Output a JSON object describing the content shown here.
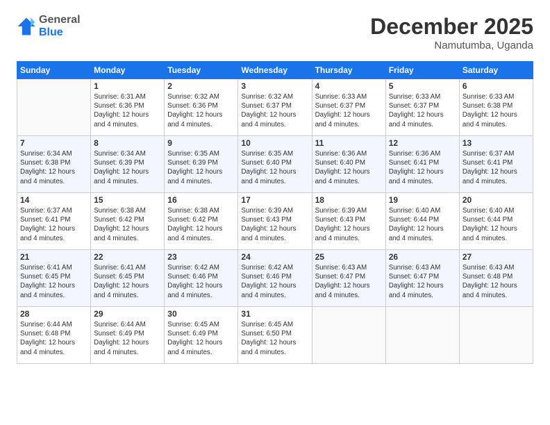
{
  "header": {
    "logo": {
      "general": "General",
      "blue": "Blue"
    },
    "month": "December 2025",
    "location": "Namutumba, Uganda"
  },
  "weekdays": [
    "Sunday",
    "Monday",
    "Tuesday",
    "Wednesday",
    "Thursday",
    "Friday",
    "Saturday"
  ],
  "weeks": [
    [
      {
        "day": null,
        "info": null
      },
      {
        "day": "1",
        "info": "Sunrise: 6:31 AM\nSunset: 6:36 PM\nDaylight: 12 hours\nand 4 minutes."
      },
      {
        "day": "2",
        "info": "Sunrise: 6:32 AM\nSunset: 6:36 PM\nDaylight: 12 hours\nand 4 minutes."
      },
      {
        "day": "3",
        "info": "Sunrise: 6:32 AM\nSunset: 6:37 PM\nDaylight: 12 hours\nand 4 minutes."
      },
      {
        "day": "4",
        "info": "Sunrise: 6:33 AM\nSunset: 6:37 PM\nDaylight: 12 hours\nand 4 minutes."
      },
      {
        "day": "5",
        "info": "Sunrise: 6:33 AM\nSunset: 6:37 PM\nDaylight: 12 hours\nand 4 minutes."
      },
      {
        "day": "6",
        "info": "Sunrise: 6:33 AM\nSunset: 6:38 PM\nDaylight: 12 hours\nand 4 minutes."
      }
    ],
    [
      {
        "day": "7",
        "info": "Sunrise: 6:34 AM\nSunset: 6:38 PM\nDaylight: 12 hours\nand 4 minutes."
      },
      {
        "day": "8",
        "info": "Sunrise: 6:34 AM\nSunset: 6:39 PM\nDaylight: 12 hours\nand 4 minutes."
      },
      {
        "day": "9",
        "info": "Sunrise: 6:35 AM\nSunset: 6:39 PM\nDaylight: 12 hours\nand 4 minutes."
      },
      {
        "day": "10",
        "info": "Sunrise: 6:35 AM\nSunset: 6:40 PM\nDaylight: 12 hours\nand 4 minutes."
      },
      {
        "day": "11",
        "info": "Sunrise: 6:36 AM\nSunset: 6:40 PM\nDaylight: 12 hours\nand 4 minutes."
      },
      {
        "day": "12",
        "info": "Sunrise: 6:36 AM\nSunset: 6:41 PM\nDaylight: 12 hours\nand 4 minutes."
      },
      {
        "day": "13",
        "info": "Sunrise: 6:37 AM\nSunset: 6:41 PM\nDaylight: 12 hours\nand 4 minutes."
      }
    ],
    [
      {
        "day": "14",
        "info": "Sunrise: 6:37 AM\nSunset: 6:41 PM\nDaylight: 12 hours\nand 4 minutes."
      },
      {
        "day": "15",
        "info": "Sunrise: 6:38 AM\nSunset: 6:42 PM\nDaylight: 12 hours\nand 4 minutes."
      },
      {
        "day": "16",
        "info": "Sunrise: 6:38 AM\nSunset: 6:42 PM\nDaylight: 12 hours\nand 4 minutes."
      },
      {
        "day": "17",
        "info": "Sunrise: 6:39 AM\nSunset: 6:43 PM\nDaylight: 12 hours\nand 4 minutes."
      },
      {
        "day": "18",
        "info": "Sunrise: 6:39 AM\nSunset: 6:43 PM\nDaylight: 12 hours\nand 4 minutes."
      },
      {
        "day": "19",
        "info": "Sunrise: 6:40 AM\nSunset: 6:44 PM\nDaylight: 12 hours\nand 4 minutes."
      },
      {
        "day": "20",
        "info": "Sunrise: 6:40 AM\nSunset: 6:44 PM\nDaylight: 12 hours\nand 4 minutes."
      }
    ],
    [
      {
        "day": "21",
        "info": "Sunrise: 6:41 AM\nSunset: 6:45 PM\nDaylight: 12 hours\nand 4 minutes."
      },
      {
        "day": "22",
        "info": "Sunrise: 6:41 AM\nSunset: 6:45 PM\nDaylight: 12 hours\nand 4 minutes."
      },
      {
        "day": "23",
        "info": "Sunrise: 6:42 AM\nSunset: 6:46 PM\nDaylight: 12 hours\nand 4 minutes."
      },
      {
        "day": "24",
        "info": "Sunrise: 6:42 AM\nSunset: 6:46 PM\nDaylight: 12 hours\nand 4 minutes."
      },
      {
        "day": "25",
        "info": "Sunrise: 6:43 AM\nSunset: 6:47 PM\nDaylight: 12 hours\nand 4 minutes."
      },
      {
        "day": "26",
        "info": "Sunrise: 6:43 AM\nSunset: 6:47 PM\nDaylight: 12 hours\nand 4 minutes."
      },
      {
        "day": "27",
        "info": "Sunrise: 6:43 AM\nSunset: 6:48 PM\nDaylight: 12 hours\nand 4 minutes."
      }
    ],
    [
      {
        "day": "28",
        "info": "Sunrise: 6:44 AM\nSunset: 6:48 PM\nDaylight: 12 hours\nand 4 minutes."
      },
      {
        "day": "29",
        "info": "Sunrise: 6:44 AM\nSunset: 6:49 PM\nDaylight: 12 hours\nand 4 minutes."
      },
      {
        "day": "30",
        "info": "Sunrise: 6:45 AM\nSunset: 6:49 PM\nDaylight: 12 hours\nand 4 minutes."
      },
      {
        "day": "31",
        "info": "Sunrise: 6:45 AM\nSunset: 6:50 PM\nDaylight: 12 hours\nand 4 minutes."
      },
      {
        "day": null,
        "info": null
      },
      {
        "day": null,
        "info": null
      },
      {
        "day": null,
        "info": null
      }
    ]
  ]
}
